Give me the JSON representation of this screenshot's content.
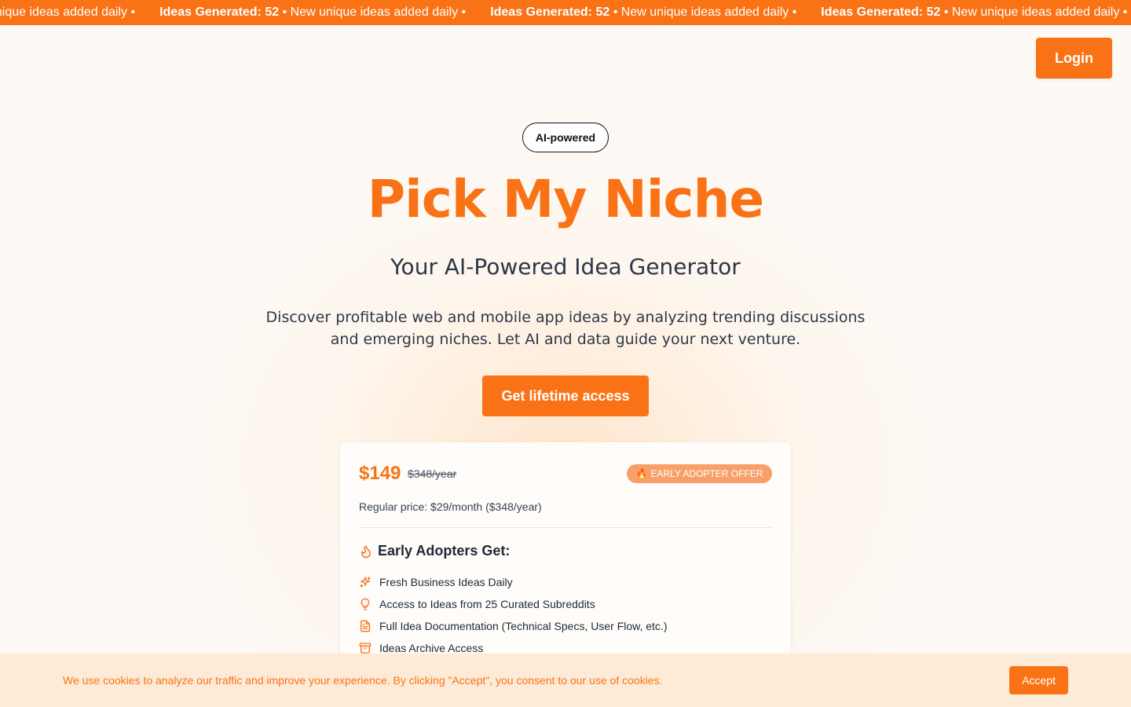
{
  "ticker": {
    "items": [
      {
        "label": "",
        "count": "",
        "tail": "w unique ideas added daily •"
      },
      {
        "label": "Ideas Generated:",
        "count": "52",
        "tail": "• New unique ideas added daily •"
      },
      {
        "label": "Ideas Generated:",
        "count": "52",
        "tail": "• New unique ideas added daily •"
      },
      {
        "label": "Ideas Generated:",
        "count": "52",
        "tail": "• New unique ideas added daily •"
      }
    ]
  },
  "header": {
    "login_label": "Login"
  },
  "hero": {
    "badge": "AI-powered",
    "title": "Pick My Niche",
    "subtitle": "Your AI-Powered Idea Generator",
    "description": "Discover profitable web and mobile app ideas by analyzing trending discussions and emerging niches. Let AI and data guide your next venture.",
    "cta_label": "Get lifetime access"
  },
  "pricing": {
    "price": "$149",
    "old_price": "$348/year",
    "offer_icon": "fire-emoji",
    "offer_label": "EARLY ADOPTER OFFER",
    "regular": "Regular price: $29/month ($348/year)",
    "heading": "Early Adopters Get:",
    "heading_icon": "flame-icon",
    "features": [
      {
        "icon": "sparkles-icon",
        "label": "Fresh Business Ideas Daily"
      },
      {
        "icon": "lightbulb-icon",
        "label": "Access to Ideas from 25 Curated Subreddits"
      },
      {
        "icon": "document-icon",
        "label": "Full Idea Documentation (Technical Specs, User Flow, etc.)"
      },
      {
        "icon": "archive-icon",
        "label": "Ideas Archive Access"
      }
    ]
  },
  "cookie": {
    "text": "We use cookies to analyze our traffic and improve your experience. By clicking \"Accept\", you consent to our use of cookies.",
    "accept_label": "Accept"
  },
  "colors": {
    "accent": "#f97316",
    "badge_bg": "#f9a06a",
    "cookie_bg": "#fdebd8"
  }
}
